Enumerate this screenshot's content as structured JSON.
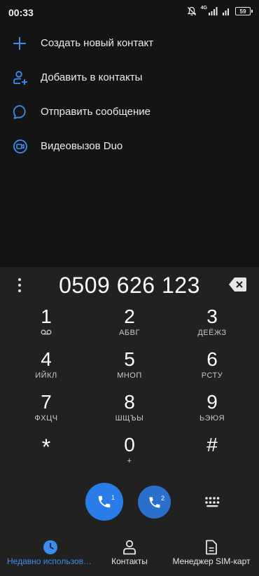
{
  "status_bar": {
    "time": "00:33",
    "network": "4G",
    "battery": "59"
  },
  "actions": [
    {
      "label": "Создать новый контакт",
      "icon": "plus-icon"
    },
    {
      "label": "Добавить в контакты",
      "icon": "add-person-icon"
    },
    {
      "label": "Отправить сообщение",
      "icon": "message-bubble-icon"
    },
    {
      "label": "Видеовызов Duo",
      "icon": "duo-video-icon"
    }
  ],
  "dialer": {
    "number": "0509 626 123",
    "keys": [
      {
        "digit": "1",
        "letters": ""
      },
      {
        "digit": "2",
        "letters": "АБВГ"
      },
      {
        "digit": "3",
        "letters": "ДЕЁЖЗ"
      },
      {
        "digit": "4",
        "letters": "ИЙКЛ"
      },
      {
        "digit": "5",
        "letters": "МНОП"
      },
      {
        "digit": "6",
        "letters": "РСТУ"
      },
      {
        "digit": "7",
        "letters": "ФХЦЧ"
      },
      {
        "digit": "8",
        "letters": "ШЩЪЫ"
      },
      {
        "digit": "9",
        "letters": "ЬЭЮЯ"
      },
      {
        "digit": "*",
        "letters": ""
      },
      {
        "digit": "0",
        "letters": "+"
      },
      {
        "digit": "#",
        "letters": ""
      }
    ],
    "sim1_label": "1",
    "sim2_label": "2"
  },
  "nav": {
    "tabs": [
      {
        "label": "Недавно использованные",
        "icon": "clock-icon",
        "active": true
      },
      {
        "label": "Контакты",
        "icon": "person-icon",
        "active": false
      },
      {
        "label": "Менеджер SIM-карт",
        "icon": "sim-card-icon",
        "active": false
      }
    ]
  },
  "colors": {
    "accent": "#3b8ef0",
    "call_button": "#2a7de8",
    "background": "#141414",
    "dialer_background": "#212121"
  }
}
